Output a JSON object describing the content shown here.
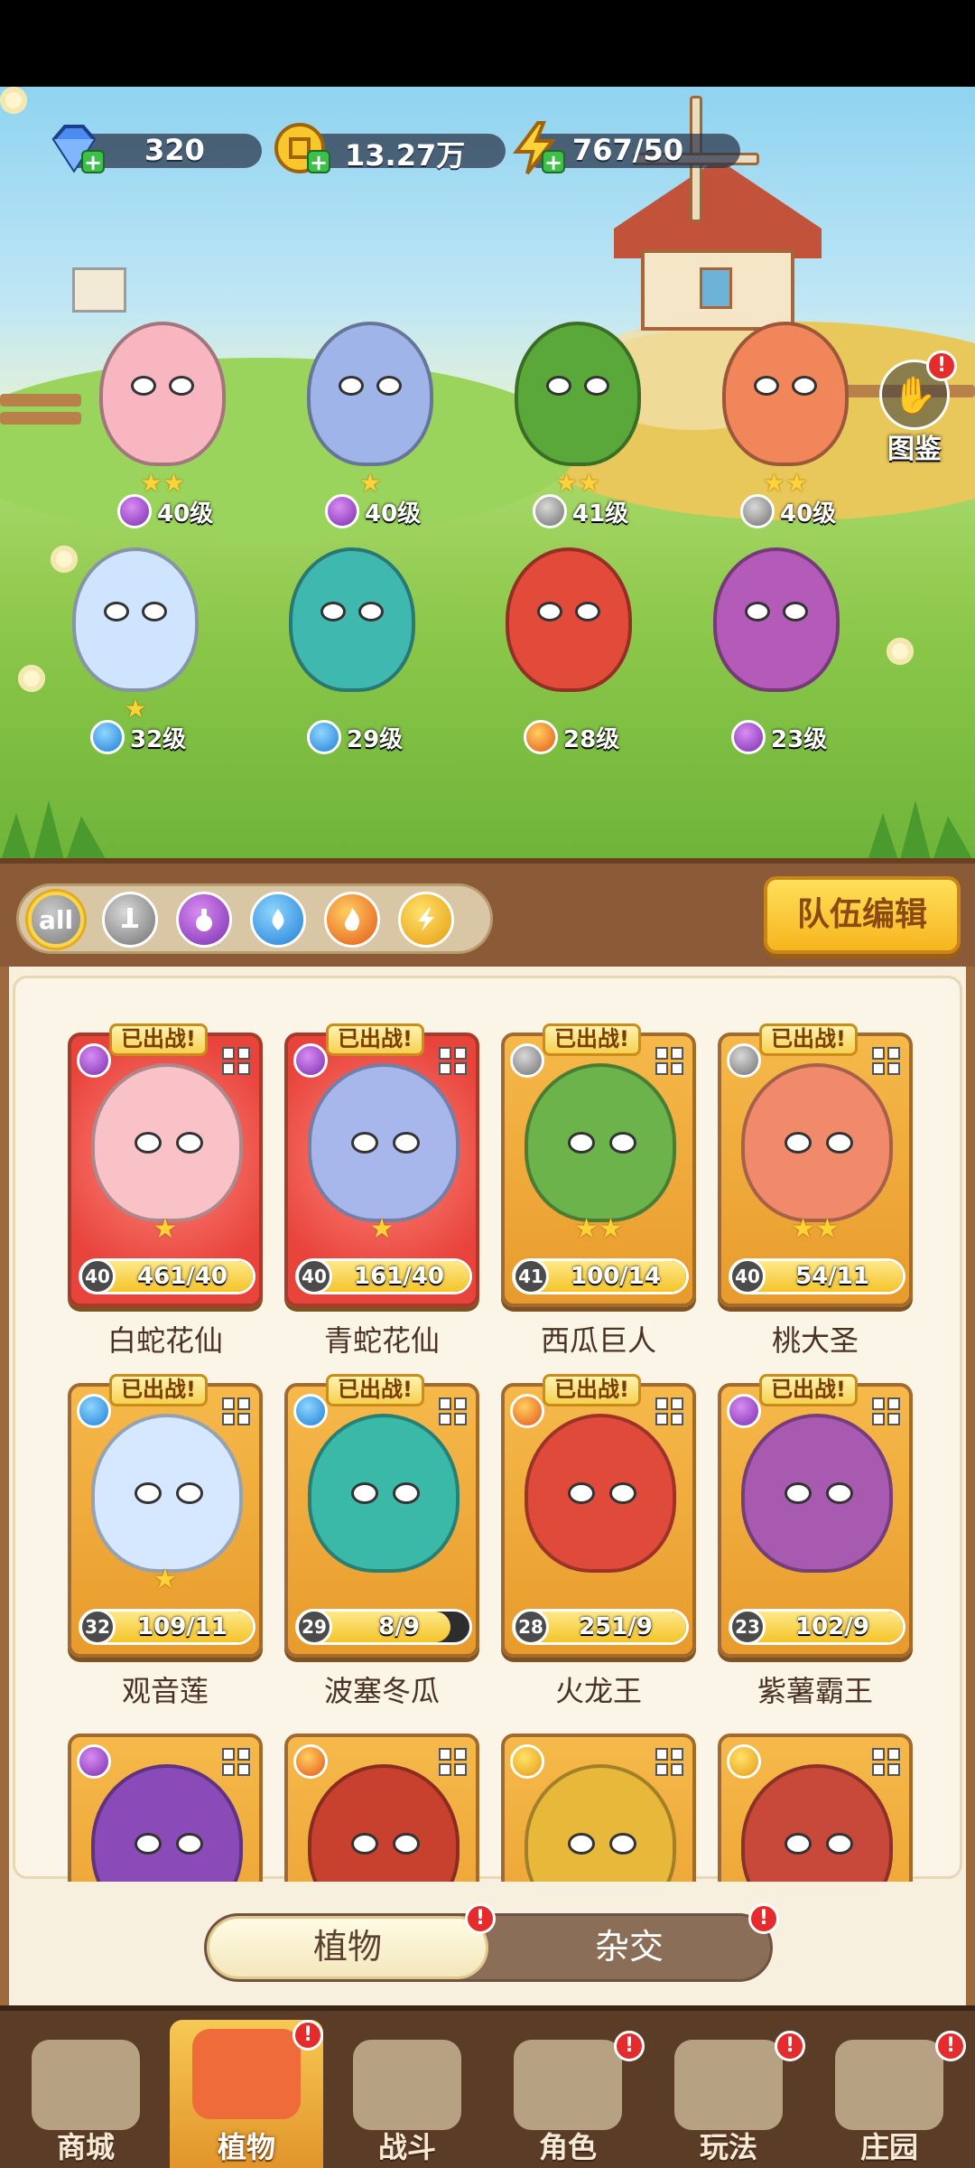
{
  "resources": {
    "gems": "320",
    "coins": "13.27万",
    "energy": "767/50"
  },
  "codex_label": "图鉴",
  "scene_team": [
    {
      "level": "40级",
      "element": "potion",
      "stars": "★★",
      "color": "#f7b6c0"
    },
    {
      "level": "40级",
      "element": "potion",
      "stars": "★",
      "color": "#9fb4e8"
    },
    {
      "level": "41级",
      "element": "sword",
      "stars": "★★",
      "color": "#5aa83a"
    },
    {
      "level": "40级",
      "element": "sword",
      "stars": "★★",
      "color": "#f0865a"
    },
    {
      "level": "32级",
      "element": "water",
      "stars": "★",
      "color": "#cfe4ff"
    },
    {
      "level": "29级",
      "element": "water",
      "stars": "",
      "color": "#3fb8b0"
    },
    {
      "level": "28级",
      "element": "fire",
      "stars": "",
      "color": "#e24a3a"
    },
    {
      "level": "23级",
      "element": "potion",
      "stars": "",
      "color": "#b45ab8"
    }
  ],
  "filters": {
    "all_label": "all",
    "icons": [
      "sword-icon",
      "potion-icon",
      "water-icon",
      "fire-icon",
      "bolt-icon"
    ]
  },
  "team_edit_label": "队伍编辑",
  "deployed_label": "已出战!",
  "cards": [
    {
      "name": "白蛇花仙",
      "level": "40",
      "fragments": "461/40",
      "fill": 1.0,
      "stars": "★",
      "element": "potion",
      "red": true,
      "upgrade": false,
      "deployed": true,
      "color": "#f9c2c6"
    },
    {
      "name": "青蛇花仙",
      "level": "40",
      "fragments": "161/40",
      "fill": 1.0,
      "stars": "★",
      "element": "potion",
      "red": true,
      "upgrade": false,
      "deployed": true,
      "color": "#a7b7ec"
    },
    {
      "name": "西瓜巨人",
      "level": "41",
      "fragments": "100/14",
      "fill": 1.0,
      "stars": "★★",
      "element": "sword",
      "red": false,
      "upgrade": true,
      "deployed": true,
      "color": "#6bb34a"
    },
    {
      "name": "桃大圣",
      "level": "40",
      "fragments": "54/11",
      "fill": 1.0,
      "stars": "★★",
      "element": "sword",
      "red": false,
      "upgrade": true,
      "deployed": true,
      "color": "#f08a6a"
    },
    {
      "name": "观音莲",
      "level": "32",
      "fragments": "109/11",
      "fill": 1.0,
      "stars": "★",
      "element": "water",
      "red": false,
      "upgrade": true,
      "deployed": true,
      "color": "#d6e8ff"
    },
    {
      "name": "波塞冬瓜",
      "level": "29",
      "fragments": "8/9",
      "fill": 0.89,
      "stars": "",
      "element": "water",
      "red": false,
      "upgrade": false,
      "deployed": true,
      "color": "#3ab8a8"
    },
    {
      "name": "火龙王",
      "level": "28",
      "fragments": "251/9",
      "fill": 1.0,
      "stars": "",
      "element": "fire",
      "red": false,
      "upgrade": true,
      "deployed": true,
      "color": "#e04a3a"
    },
    {
      "name": "紫薯霸王",
      "level": "23",
      "fragments": "102/9",
      "fill": 1.0,
      "stars": "",
      "element": "potion",
      "red": false,
      "upgrade": true,
      "deployed": true,
      "color": "#a85ab0"
    },
    {
      "name": "",
      "level": "",
      "fragments": "",
      "fill": 0,
      "stars": "",
      "element": "potion",
      "red": false,
      "upgrade": false,
      "deployed": false,
      "color": "#8a4ab8"
    },
    {
      "name": "",
      "level": "",
      "fragments": "",
      "fill": 0,
      "stars": "",
      "element": "fire",
      "red": false,
      "upgrade": false,
      "deployed": false,
      "color": "#c8402e"
    },
    {
      "name": "",
      "level": "",
      "fragments": "",
      "fill": 0,
      "stars": "",
      "element": "bolt",
      "red": false,
      "upgrade": false,
      "deployed": false,
      "color": "#e8b83a"
    },
    {
      "name": "",
      "level": "",
      "fragments": "",
      "fill": 0,
      "stars": "",
      "element": "bolt",
      "red": false,
      "upgrade": false,
      "deployed": false,
      "color": "#c8483a"
    }
  ],
  "tabs": {
    "plants": "植物",
    "hybrid": "杂交"
  },
  "nav": [
    {
      "label": "商城",
      "active": false,
      "badge": false
    },
    {
      "label": "植物",
      "active": true,
      "badge": true
    },
    {
      "label": "战斗",
      "active": false,
      "badge": false
    },
    {
      "label": "角色",
      "active": false,
      "badge": true
    },
    {
      "label": "玩法",
      "active": false,
      "badge": true
    },
    {
      "label": "庄园",
      "active": false,
      "badge": true
    }
  ],
  "badge_mark": "!"
}
